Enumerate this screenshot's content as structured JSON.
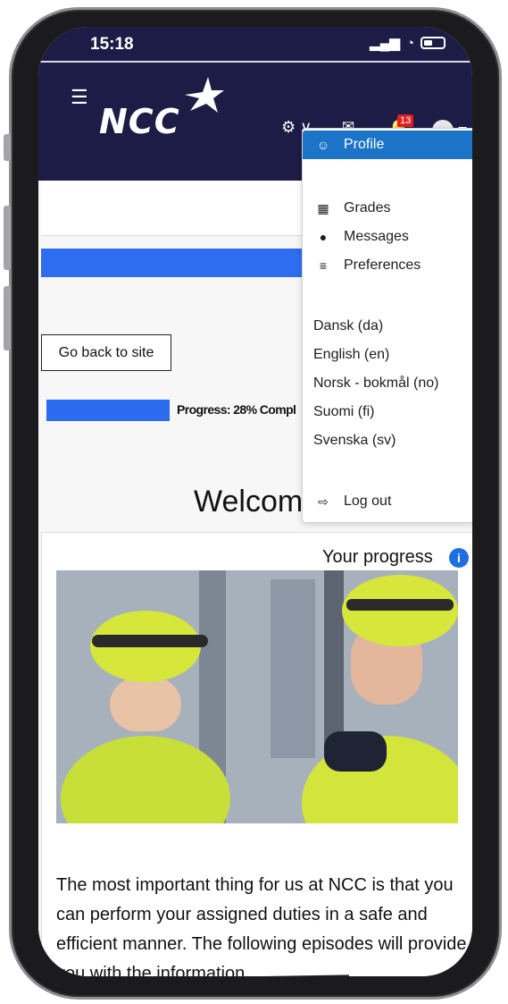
{
  "status_bar": {
    "time": "15:18",
    "signal": "▂▄▆",
    "wifi": "◔"
  },
  "navbar": {
    "brand": "NCC",
    "menu_icon": "☰",
    "settings_icon": "⚙ ∨",
    "mail_icon": "✉",
    "bell_icon": "🔔",
    "notification_count": "13"
  },
  "user_menu": {
    "items": [
      {
        "label": "Profile",
        "icon": "user-icon"
      },
      {
        "label": "Grades",
        "icon": "table-icon"
      },
      {
        "label": "Messages",
        "icon": "chat-bubble-icon"
      },
      {
        "label": "Preferences",
        "icon": "sliders-icon"
      }
    ],
    "languages": [
      "Dansk (da)",
      "English (en)",
      "Norsk - bokmål (no)",
      "Suomi (fi)",
      "Svenska (sv)"
    ],
    "logout_label": "Log out"
  },
  "main": {
    "back_button": "Go back to site",
    "progress_text": "Progress: 28% Compl",
    "progress_value": 0.28,
    "welcome": "Welcom",
    "your_progress": "Your progress",
    "info_glyph": "i",
    "body_text": "The most important thing for us at NCC is that you can perform your assigned duties in a safe and efficient manner. The following episodes will provide you with the information"
  },
  "colors": {
    "navy": "#1c1c46",
    "accent_blue": "#2e6cf0",
    "active_menu": "#1b74c8",
    "badge_red": "#e02020"
  }
}
